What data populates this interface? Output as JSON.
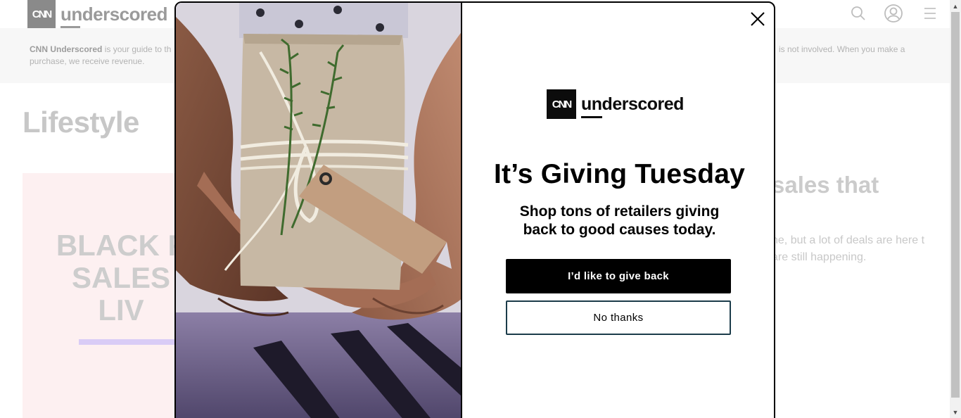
{
  "header": {
    "logo_mark": "CNN",
    "logo_word": "underscored",
    "icons": [
      "search-icon",
      "account-icon",
      "menu-icon"
    ]
  },
  "banner": {
    "brand": "CNN Underscored",
    "text_left": " is your guide to th",
    "text_left_line2": "purchase, we receive revenue.",
    "text_right": "is not involved. When you make a"
  },
  "page": {
    "title": "Lifestyle",
    "hero_text_line1": "BLACK F",
    "hero_text_line2": "SALES",
    "hero_text_line3": "LIV",
    "article_title": "sales that",
    "article_desc": "ne, but a lot of deals are here t are still happening."
  },
  "modal": {
    "logo_mark": "CNN",
    "logo_word": "underscored",
    "headline": "It’s Giving Tuesday",
    "subhead": "Shop tons of retailers giving back to good causes today.",
    "primary_button": "I’d like to give back",
    "secondary_button": "No thanks",
    "close_icon": "close-icon"
  },
  "colors": {
    "modal_border": "#000000",
    "primary_button_bg": "#000000",
    "secondary_button_border": "#1b3c4a",
    "hero_bg": "#fdf0f1",
    "hero_accent": "#d9ccf6"
  }
}
